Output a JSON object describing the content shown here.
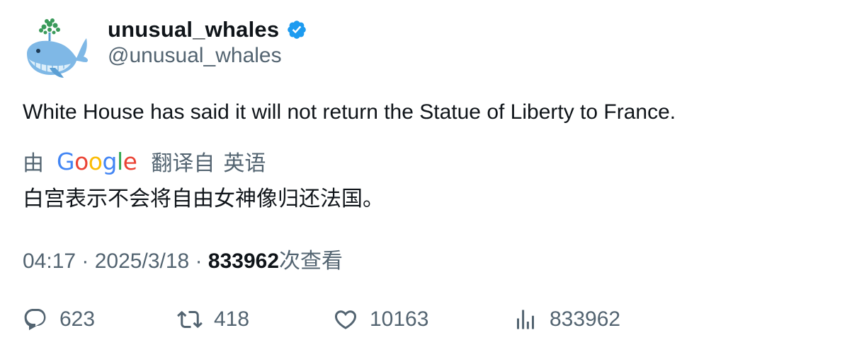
{
  "author": {
    "display_name": "unusual_whales",
    "handle": "@unusual_whales",
    "verified": true,
    "verified_color": "#1d9bf0"
  },
  "tweet": {
    "text": "White House has said it will not return the Statue of Liberty to France."
  },
  "translation": {
    "by_label": "由",
    "provider": "Google",
    "from_label": "翻译自",
    "language": "英语",
    "text": "白宫表示不会将自由女神像归还法国。"
  },
  "meta": {
    "time": "04:17",
    "separator": "·",
    "date": "2025/3/18",
    "views_count": "833962",
    "views_label": "次查看"
  },
  "actions": {
    "reply": {
      "icon": "reply-icon",
      "count": "623"
    },
    "retweet": {
      "icon": "retweet-icon",
      "count": "418"
    },
    "like": {
      "icon": "heart-icon",
      "count": "10163"
    },
    "views": {
      "icon": "analytics-icon",
      "count": "833962"
    }
  },
  "colors": {
    "text_primary": "#0f1419",
    "text_secondary": "#536471",
    "avatar_whale": "#7fb8e6",
    "avatar_spray": "#3a9a5a"
  }
}
